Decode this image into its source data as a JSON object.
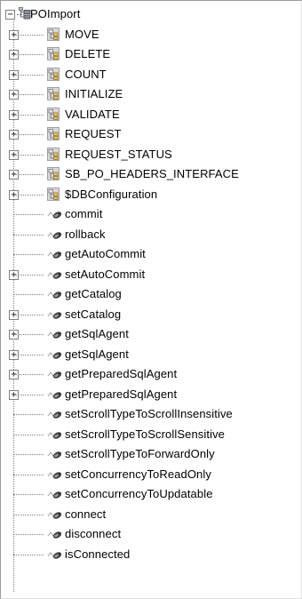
{
  "tree": {
    "root": {
      "label": "POImport",
      "expander": "−",
      "icon": "hierarchy-icon"
    },
    "packages": [
      {
        "label": "MOVE",
        "expander": "+",
        "icon": "package-icon"
      },
      {
        "label": "DELETE",
        "expander": "+",
        "icon": "package-icon"
      },
      {
        "label": "COUNT",
        "expander": "+",
        "icon": "package-icon"
      },
      {
        "label": "INITIALIZE",
        "expander": "+",
        "icon": "package-icon"
      },
      {
        "label": "VALIDATE",
        "expander": "+",
        "icon": "package-icon"
      },
      {
        "label": "REQUEST",
        "expander": "+",
        "icon": "package-icon"
      },
      {
        "label": "REQUEST_STATUS",
        "expander": "+",
        "icon": "package-icon"
      },
      {
        "label": "SB_PO_HEADERS_INTERFACE",
        "expander": "+",
        "icon": "package-icon"
      },
      {
        "label": "$DBConfiguration",
        "expander": "+",
        "icon": "package-icon"
      }
    ],
    "methods": [
      {
        "label": "commit",
        "expandable": false,
        "icon": "method-icon"
      },
      {
        "label": "rollback",
        "expandable": false,
        "icon": "method-icon"
      },
      {
        "label": "getAutoCommit",
        "expandable": false,
        "icon": "method-icon"
      },
      {
        "label": "setAutoCommit",
        "expandable": true,
        "expander": "+",
        "icon": "method-icon"
      },
      {
        "label": "getCatalog",
        "expandable": false,
        "icon": "method-icon"
      },
      {
        "label": "setCatalog",
        "expandable": true,
        "expander": "+",
        "icon": "method-icon"
      },
      {
        "label": "getSqlAgent",
        "expandable": true,
        "expander": "+",
        "icon": "method-icon"
      },
      {
        "label": "getSqlAgent",
        "expandable": true,
        "expander": "+",
        "icon": "method-icon"
      },
      {
        "label": "getPreparedSqlAgent",
        "expandable": true,
        "expander": "+",
        "icon": "method-icon"
      },
      {
        "label": "getPreparedSqlAgent",
        "expandable": true,
        "expander": "+",
        "icon": "method-icon"
      },
      {
        "label": "setScrollTypeToScrollInsensitive",
        "expandable": false,
        "icon": "method-icon"
      },
      {
        "label": "setScrollTypeToScrollSensitive",
        "expandable": false,
        "icon": "method-icon"
      },
      {
        "label": "setScrollTypeToForwardOnly",
        "expandable": false,
        "icon": "method-icon"
      },
      {
        "label": "setConcurrencyToReadOnly",
        "expandable": false,
        "icon": "method-icon"
      },
      {
        "label": "setConcurrencyToUpdatable",
        "expandable": false,
        "icon": "method-icon"
      },
      {
        "label": "connect",
        "expandable": false,
        "icon": "method-icon"
      },
      {
        "label": "disconnect",
        "expandable": false,
        "icon": "method-icon"
      },
      {
        "label": "isConnected",
        "expandable": false,
        "icon": "method-icon"
      }
    ]
  }
}
